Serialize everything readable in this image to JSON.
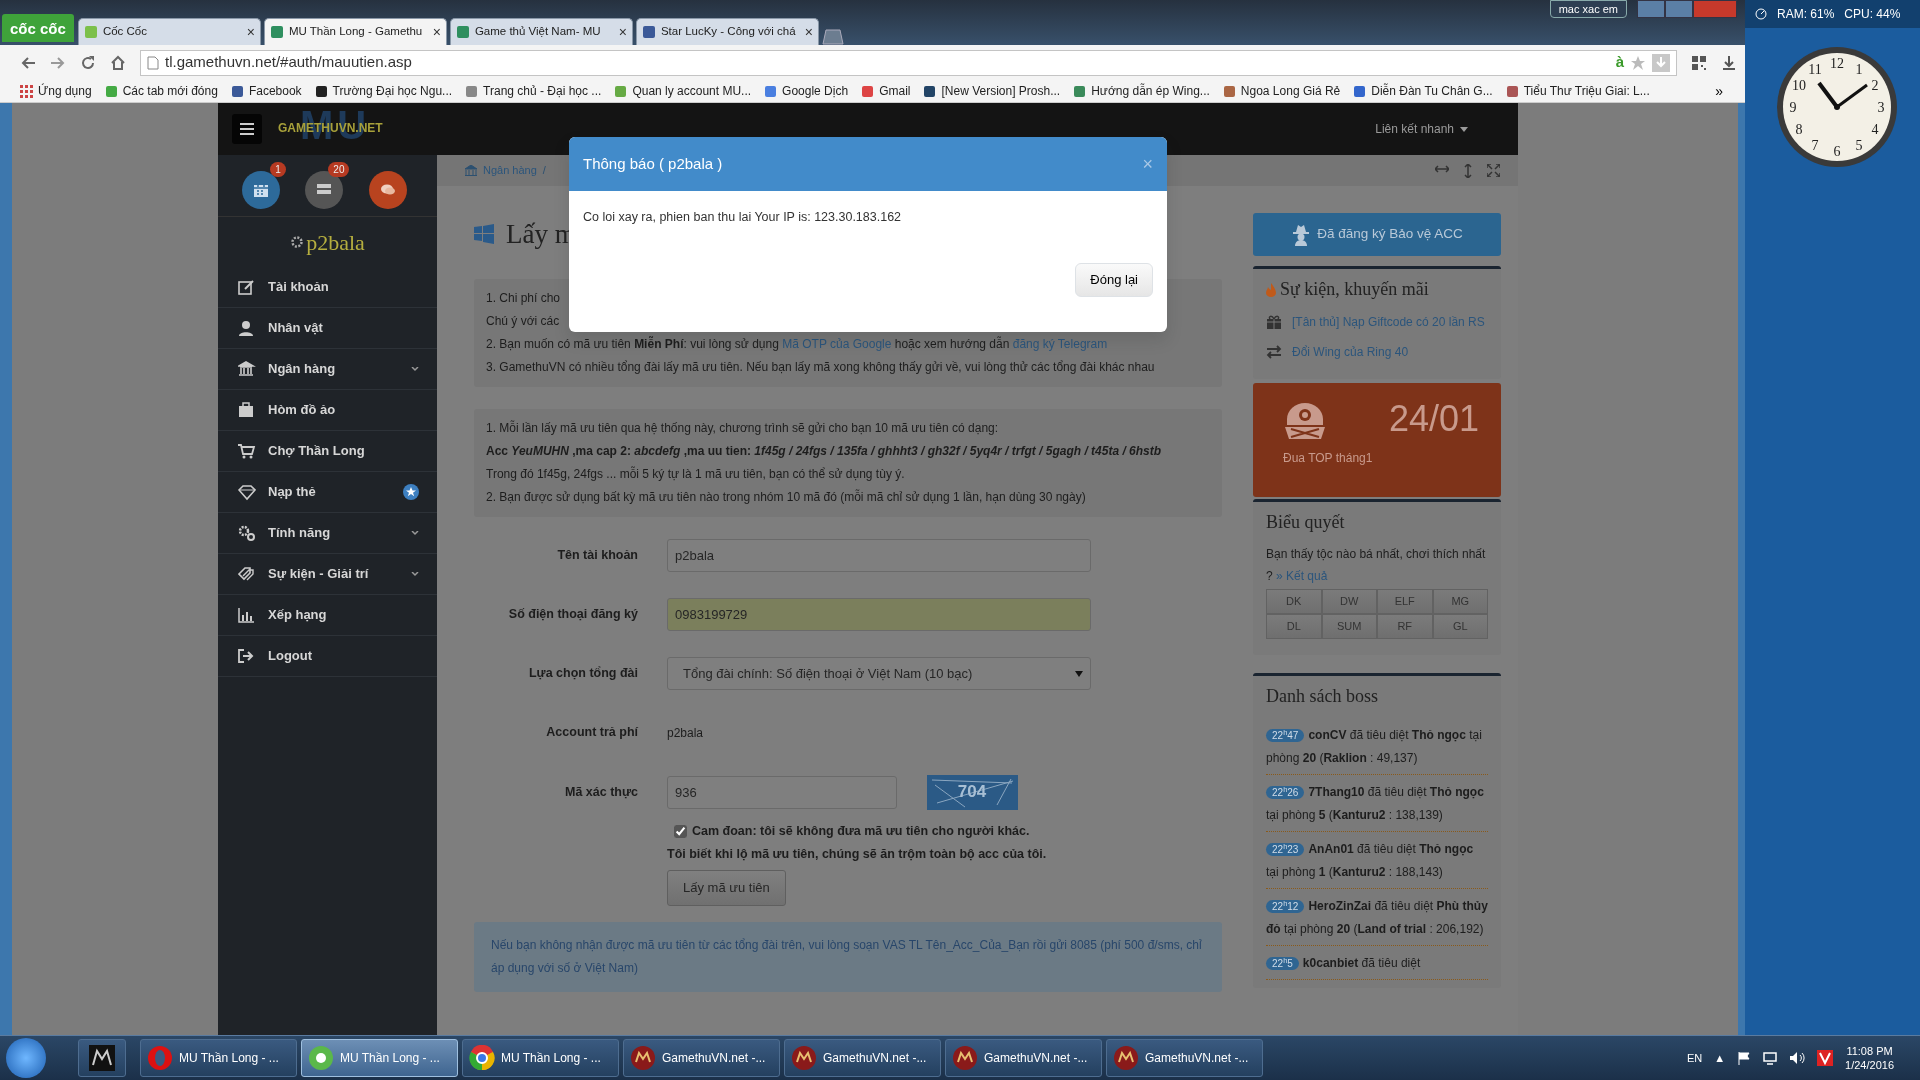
{
  "window": {
    "badge": "mac xac em"
  },
  "browser": {
    "logo": "cốc cốc",
    "tabs": [
      {
        "label": "Cốc Cốc",
        "close": "×",
        "selected": false
      },
      {
        "label": "MU Thần Long - Gamethu",
        "close": "×",
        "selected": true
      },
      {
        "label": "Game thủ Việt Nam- MU",
        "close": "×",
        "selected": false
      },
      {
        "label": "Star LucKy - Công với chá",
        "close": "×",
        "selected": false
      }
    ],
    "address": "tl.gamethuvn.net/#auth/mauutien.asp",
    "input_mode": "à",
    "bookmarks": [
      "Ứng dụng",
      "Các tab mới đóng",
      "Facebook",
      "Trường Đại học Ngu...",
      "Trang chủ - Đại học ...",
      "Quan ly account MU...",
      "Google Dịch",
      "Gmail",
      "[New Version] Prosh...",
      "Hướng dẫn ép Wing...",
      "Ngoa Long Giá Rẻ",
      "Diễn Đàn Tu Chân G...",
      "Tiểu Thư Triệu Giai: L..."
    ],
    "more": "»"
  },
  "site": {
    "logo": {
      "big": "MU",
      "small": "GAMETHUVN.NET"
    },
    "quick_links": "Liên kết nhanh",
    "notifications": [
      {
        "kind": "calendar",
        "count": "1"
      },
      {
        "kind": "list",
        "count": "20"
      },
      {
        "kind": "chat"
      }
    ],
    "username": "p2bala",
    "menu": [
      {
        "kind": "edit",
        "label": "Tài khoản"
      },
      {
        "kind": "user",
        "label": "Nhân vật"
      },
      {
        "kind": "bank",
        "label": "Ngân hàng",
        "expandable": true
      },
      {
        "kind": "box",
        "label": "Hòm đồ ảo"
      },
      {
        "kind": "cart",
        "label": "Chợ Thần Long"
      },
      {
        "kind": "diamond",
        "label": "Nạp thẻ",
        "starred": true
      },
      {
        "kind": "gears",
        "label": "Tính năng",
        "expandable": true
      },
      {
        "kind": "tags",
        "label": "Sự kiện - Giải trí",
        "expandable": true
      },
      {
        "kind": "chart",
        "label": "Xếp hạng"
      },
      {
        "kind": "logout",
        "label": "Logout"
      }
    ],
    "breadcrumb": [
      {
        "label": "Ngân hàng"
      },
      {
        "label": "/"
      }
    ],
    "title": "Lấy m",
    "notice": [
      {
        "segments": [
          {
            "text": "1. Chi phí cho"
          }
        ]
      },
      {
        "segments": [
          {
            "text": "Chú ý với các"
          }
        ]
      },
      {
        "segments": [
          {
            "text": "2. Bạn muốn có mã ưu tiên **Miễn Phí**: vui lòng sử dụng "
          },
          {
            "text": "Mã OTP của Google",
            "link": true
          },
          {
            "text": " hoặc xem hướng dẫn "
          },
          {
            "text": "đăng ký Telegram",
            "link": true
          }
        ]
      },
      {
        "segments": [
          {
            "text": "3. GamethuVN có nhiều tổng đài lấy mã ưu tiên. Nếu bạn lấy mã xong không thấy gửi về, vui lòng thử các tổng đài khác nhau"
          }
        ]
      }
    ],
    "code_info": [
      {
        "text": "1. Mỗi lần lấy mã ưu tiên qua hệ thống này, chương trình sẽ gửi cho bạn 10 mã ưu tiên có dạng:"
      },
      {
        "text": "Acc *YeuMUHN* ,ma cap 2: *abcdefg* ,ma uu tien: *1f45g / 24fgs / 135fa / ghhht3 / gh32f / 5yq4r / trfgt / 5gagh / t45ta / 6hstb*",
        "bold": true
      },
      {
        "text": "Trong đó 1f45g, 24fgs ... mỗi 5 ký tự là 1 mã ưu tiên, bạn có thể sử dụng tùy ý."
      },
      {
        "text": "2. Bạn được sử dụng bất kỳ mã ưu tiên nào trong nhóm 10 mã đó (mỗi mã chỉ sử dụng 1 lần, hạn dùng 30 ngày)"
      }
    ],
    "form": {
      "rows": [
        {
          "kind": "text",
          "label": "Tên tài khoản",
          "value": "p2bala"
        },
        {
          "kind": "text",
          "label": "Số điện thoại đăng ký",
          "value": "0983199729",
          "autofilled": true
        },
        {
          "kind": "select",
          "label": "Lựa chọn tổng đài",
          "value": "Tổng đài chính: Số điện thoại ở Việt Nam (10 bạc)"
        },
        {
          "kind": "static",
          "label": "Account trả phí",
          "value": "p2bala"
        },
        {
          "kind": "captcha",
          "label": "Mã xác thực",
          "value": "936",
          "captcha": "704"
        }
      ],
      "agree": {
        "checked": true,
        "label": "Cam đoan: tôi sẽ không đưa mã ưu tiên cho người khác.",
        "note": "Tôi biết khi lộ mã ưu tiên, chúng sẽ ăn trộm toàn bộ acc của tôi."
      },
      "submit": "Lấy mã ưu tiên"
    },
    "sms_note": "Nếu bạn không nhận được mã ưu tiên từ các tổng đài trên, vui lòng soạn VAS TL Tên_Acc_Của_Bạn rồi gửi 8085 (phí 500 đ/sms, chỉ áp dụng với số ở Việt Nam)",
    "protect_button": "Đã đăng ký Bảo vệ ACC",
    "events": {
      "title": "Sự kiện, khuyến mãi",
      "items": [
        {
          "kind": "gift",
          "label": "[Tân thủ] Nạp Giftcode có 20 lần RS"
        },
        {
          "kind": "exchange",
          "label": "Đổi Wing của Ring 40"
        }
      ]
    },
    "top_card": {
      "date": "24/01",
      "caption": "Đua TOP tháng1"
    },
    "vote": {
      "title": "Biểu quyết",
      "question": "Bạn thấy tộc nào bá nhất, chơi thích nhất ? ",
      "results_link": "» Kết quả",
      "options": [
        "DK",
        "DW",
        "ELF",
        "MG",
        "DL",
        "SUM",
        "RF",
        "GL"
      ]
    },
    "bosses": {
      "title": "Danh sách boss",
      "items": [
        {
          "time": "22$^{h}$47",
          "text": "**conCV** đã tiêu diệt **Thỏ ngọc** tại phòng **20** (**Raklion** : 49,137)"
        },
        {
          "time": "22$^{h}$26",
          "text": "**7Thang10** đã tiêu diệt **Thỏ ngọc** tại phòng **5** (**Kanturu2** : 138,139)"
        },
        {
          "time": "22$^{h}$23",
          "text": "**AnAn01** đã tiêu diệt **Thỏ ngọc** tại phòng **1** (**Kanturu2** : 188,143)"
        },
        {
          "time": "22$^{h}$12",
          "text": "**HeroZinZai** đã tiêu diệt **Phù thủy đỏ** tại phòng **20** (**Land of trial** : 206,192)"
        },
        {
          "time": "22$^{h}$5",
          "text": "**k0canbiet** đã tiêu diệt"
        }
      ]
    }
  },
  "modal": {
    "title": "Thông báo ( p2bala )",
    "close": "×",
    "message": "Co loi xay ra, phien ban thu lai Your IP is: 123.30.183.162",
    "button": "Đóng lại"
  },
  "desktop": {
    "ram": "RAM: 61%",
    "cpu": "CPU: 44%",
    "clock_numerals": [
      "12",
      "1",
      "2",
      "3",
      "4",
      "5",
      "6",
      "7",
      "8",
      "9",
      "10",
      "11"
    ]
  },
  "taskbar": {
    "items": [
      {
        "kind": "game-pinned",
        "selected": false
      },
      {
        "kind": "opera",
        "label": "MU Thần Long - ...",
        "selected": false
      },
      {
        "kind": "coccoc",
        "label": "MU Thần Long - ...",
        "selected": true
      },
      {
        "kind": "chrome",
        "label": "MU Thần Long - ...",
        "selected": false
      },
      {
        "kind": "game",
        "label": "GamethuVN.net -...",
        "selected": false
      },
      {
        "kind": "game",
        "label": "GamethuVN.net -...",
        "selected": false
      },
      {
        "kind": "game",
        "label": "GamethuVN.net -...",
        "selected": false
      },
      {
        "kind": "game",
        "label": "GamethuVN.net -...",
        "selected": false
      }
    ],
    "language": "EN",
    "tray_arrow": "▲",
    "time": "11:08 PM",
    "date": "1/24/2016"
  }
}
